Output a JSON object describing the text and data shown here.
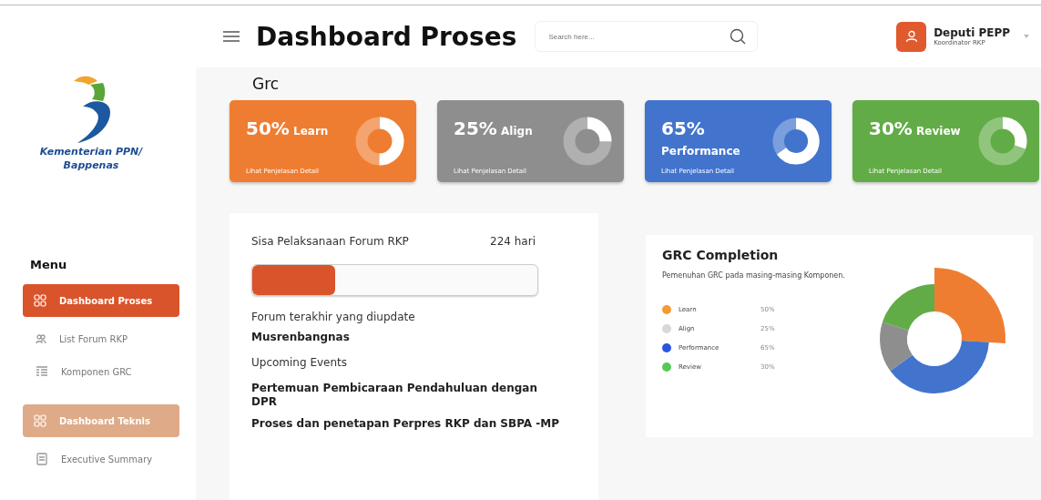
{
  "sidebar": {
    "logo_text": [
      "Kementerian PPN/",
      "Bappenas"
    ],
    "menu_title": "Menu",
    "items": [
      {
        "kind": "section",
        "label": "Dashboard Proses",
        "selected": true
      },
      {
        "kind": "link",
        "label": "List Forum RKP"
      },
      {
        "kind": "link",
        "label": "Komponen GRC"
      },
      {
        "kind": "section",
        "label": "Dashboard Teknis",
        "selected": false
      },
      {
        "kind": "link",
        "label": "Executive Summary"
      }
    ]
  },
  "header": {
    "title": "Dashboard Proses",
    "search": {
      "placeholder": "Search here..."
    },
    "user": {
      "name": "Deputi PEPP",
      "role": "Koordinator RKP"
    }
  },
  "section_title": "Grc",
  "cards": [
    {
      "percent": "50%",
      "label": "Learn",
      "link": "Lihat Penjelasan Detail",
      "color": "#ef7d31"
    },
    {
      "percent": "25%",
      "label": "Align",
      "link": "Lihat Penjelasan Detail",
      "color": "#8e8e8e"
    },
    {
      "percent": "65%",
      "label": "Performance",
      "link": "Lihat Penjelasan Detail",
      "color": "#4274cd"
    },
    {
      "percent": "30%",
      "label": "Review",
      "link": "Lihat Penjelasan Detail",
      "color": "#62ac47"
    }
  ],
  "forum": {
    "label": "Sisa Pelaksanaan Forum RKP",
    "days": "224 hari",
    "level": 0.29,
    "last_label": "Forum terakhir yang diupdate",
    "last_value": "Musrenbangnas",
    "upcoming_label": "Upcoming Events",
    "events": [
      "Pertemuan Pembicaraan Pendahuluan dengan DPR",
      "Proses dan penetapan Perpres RKP dan SBPA -MP"
    ]
  },
  "completion": {
    "title": "GRC Completion",
    "subtitle": "Pemenuhan GRC pada masing-masing Komponen.",
    "legend": [
      {
        "label": "Learn",
        "value": "50%",
        "color": "#f39a35"
      },
      {
        "label": "Align",
        "value": "25%",
        "color": "#d8d8d8"
      },
      {
        "label": "Performance",
        "value": "65%",
        "color": "#2a55e0"
      },
      {
        "label": "Review",
        "value": "30%",
        "color": "#55c956"
      }
    ]
  }
}
